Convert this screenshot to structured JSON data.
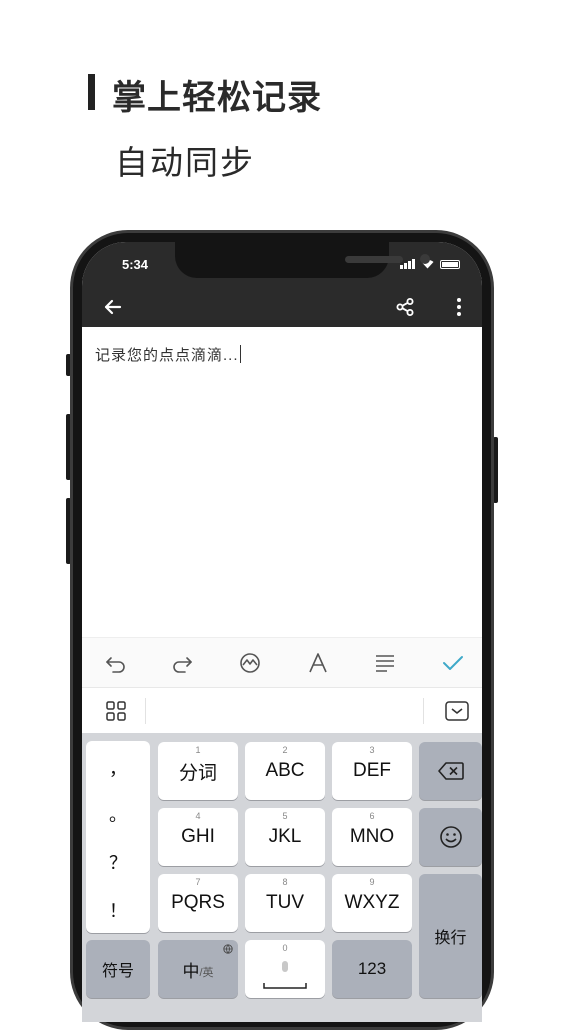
{
  "promo": {
    "title": "掌上轻松记录",
    "subtitle": "自动同步"
  },
  "status_bar": {
    "time": "5:34"
  },
  "toolbar": {
    "back_icon": "arrow-left-icon",
    "share_icon": "share-icon",
    "more_icon": "more-vertical-icon"
  },
  "editor": {
    "text": "记录您的点点滴滴..."
  },
  "format_bar": {
    "icons": [
      "undo-icon",
      "redo-icon",
      "sketch-icon",
      "font-icon",
      "align-icon",
      "check-icon"
    ],
    "accent": "#3fa9c9"
  },
  "ime_bar": {
    "icons": [
      "grid-menu-icon",
      "collapse-keyboard-icon"
    ]
  },
  "keyboard": {
    "punctuation": [
      "，",
      "。",
      "？",
      "！"
    ],
    "row1": [
      {
        "num": "1",
        "label": "分词"
      },
      {
        "num": "2",
        "label": "ABC"
      },
      {
        "num": "3",
        "label": "DEF"
      }
    ],
    "row2": [
      {
        "num": "4",
        "label": "GHI"
      },
      {
        "num": "5",
        "label": "JKL"
      },
      {
        "num": "6",
        "label": "MNO"
      }
    ],
    "row3": [
      {
        "num": "7",
        "label": "PQRS"
      },
      {
        "num": "8",
        "label": "TUV"
      },
      {
        "num": "9",
        "label": "WXYZ"
      }
    ],
    "enter": "换行",
    "symbols": "符号",
    "lang_main": "中",
    "lang_alt": "/英",
    "space_num": "0",
    "num_key": "123"
  }
}
